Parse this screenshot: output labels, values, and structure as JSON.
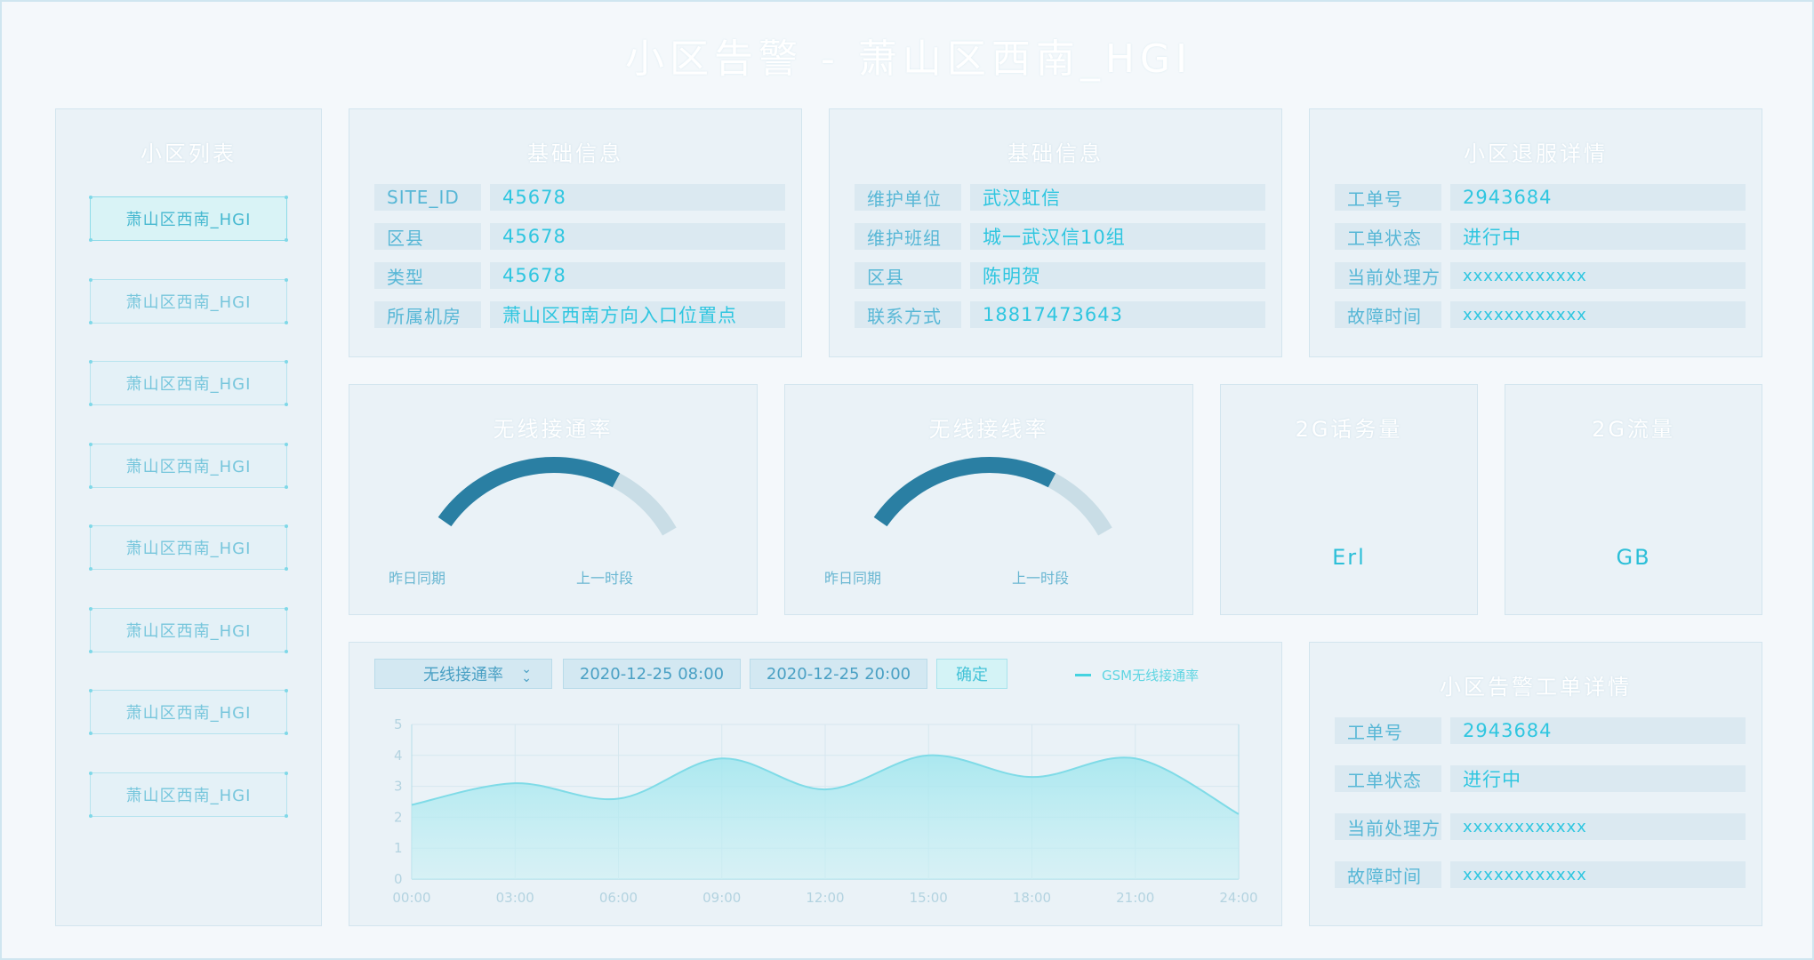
{
  "page_title": "小区告警 - 萧山区西南_HGI",
  "cell_list": {
    "title": "小区列表",
    "items": [
      "萧山区西南_HGI",
      "萧山区西南_HGI",
      "萧山区西南_HGI",
      "萧山区西南_HGI",
      "萧山区西南_HGI",
      "萧山区西南_HGI",
      "萧山区西南_HGI",
      "萧山区西南_HGI"
    ]
  },
  "basic_info_1": {
    "title": "基础信息",
    "rows": [
      {
        "label": "SITE_ID",
        "value": "45678"
      },
      {
        "label": "区县",
        "value": "45678"
      },
      {
        "label": "类型",
        "value": "45678"
      },
      {
        "label": "所属机房",
        "value": "萧山区西南方向入口位置点"
      }
    ]
  },
  "basic_info_2": {
    "title": "基础信息",
    "rows": [
      {
        "label": "维护单位",
        "value": "武汉虹信"
      },
      {
        "label": "维护班组",
        "value": "城一武汉信10组"
      },
      {
        "label": "区县",
        "value": "陈明贺"
      },
      {
        "label": "联系方式",
        "value": "18817473643"
      }
    ]
  },
  "complaint_detail": {
    "title": "小区退服详情",
    "rows": [
      {
        "label": "工单号",
        "value": "2943684"
      },
      {
        "label": "工单状态",
        "value": "进行中"
      },
      {
        "label": "当前处理方",
        "value": "xxxxxxxxxxxx"
      },
      {
        "label": "故障时间",
        "value": "xxxxxxxxxxxx"
      }
    ]
  },
  "gauge_1": {
    "title": "无线接通率",
    "left_caption": "昨日同期",
    "right_caption": "上一时段",
    "fraction": 0.72
  },
  "gauge_2": {
    "title": "无线接线率",
    "left_caption": "昨日同期",
    "right_caption": "上一时段",
    "fraction": 0.72
  },
  "traffic_2g": {
    "title": "2G话务量",
    "unit": "Erl"
  },
  "flow_2g": {
    "title": "2G流量",
    "unit": "GB"
  },
  "chart_controls": {
    "metric_select": "无线接通率",
    "start_time": "2020-12-25 08:00",
    "end_time": "2020-12-25 20:00",
    "confirm_label": "确定",
    "legend_label": "GSM无线接通率"
  },
  "chart_data": {
    "type": "area",
    "x": [
      "00:00",
      "03:00",
      "06:00",
      "09:00",
      "12:00",
      "15:00",
      "18:00",
      "21:00",
      "24:00"
    ],
    "series": [
      {
        "name": "GSM无线接通率",
        "values": [
          2.4,
          3.1,
          2.6,
          3.9,
          2.9,
          4.0,
          3.3,
          3.9,
          2.1
        ]
      }
    ],
    "ylim": [
      0,
      5
    ],
    "yticks": [
      "0",
      "1",
      "2",
      "3",
      "4",
      "5"
    ],
    "grid": true,
    "legend": "top"
  },
  "alarm_detail": {
    "title": "小区告警工单详情",
    "rows": [
      {
        "label": "工单号",
        "value": "2943684"
      },
      {
        "label": "工单状态",
        "value": "进行中"
      },
      {
        "label": "当前处理方",
        "value": "xxxxxxxxxxxx"
      },
      {
        "label": "故障时间",
        "value": "xxxxxxxxxxxx"
      }
    ]
  },
  "colors": {
    "accent": "#2fc6e0",
    "gauge_arc": "#2a7fa3",
    "gauge_track": "#c7dde6"
  }
}
